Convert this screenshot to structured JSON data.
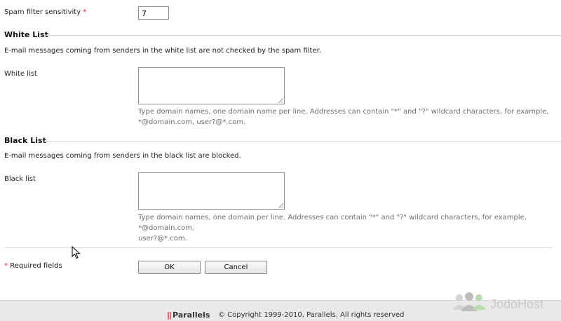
{
  "spam_filter": {
    "label": "Spam filter sensitivity",
    "required_mark": "*",
    "value": "7"
  },
  "white_list": {
    "section_title": "White List",
    "description": "E-mail messages coming from senders in the white list are not checked by the spam filter.",
    "field_label": "White list",
    "value": "",
    "hint_line1": "Type domain names, one domain name per line. Addresses can contain \"*\" and \"?\" wildcard characters, for example,",
    "hint_line2": "*@domain.com, user?@*.com."
  },
  "black_list": {
    "section_title": "Black List",
    "description": "E-mail messages coming from senders in the black list are blocked.",
    "field_label": "Black list",
    "value": "",
    "hint_line1": "Type domain names, one domain per line. Addresses can contain \"*\" and \"?\" wildcard characters, for example, *@domain.com,",
    "hint_line2": "user?@*.com."
  },
  "form": {
    "required_mark": "*",
    "required_note": "Required fields",
    "ok_label": "OK",
    "cancel_label": "Cancel"
  },
  "footer": {
    "brand_bars": "||",
    "brand_name": "Parallels",
    "copyright": "© Copyright 1999-2010, Parallels. All rights reserved"
  },
  "watermark": {
    "text": "JodoHost"
  },
  "colors": {
    "required": "#e0201c",
    "brand_red": "#d7262b",
    "footer_bg": "#e9e9e9",
    "hint_text": "#6f6f6f"
  },
  "icons": {
    "cursor": "mouse-pointer-icon",
    "watermark_logo": "people-group-icon"
  }
}
